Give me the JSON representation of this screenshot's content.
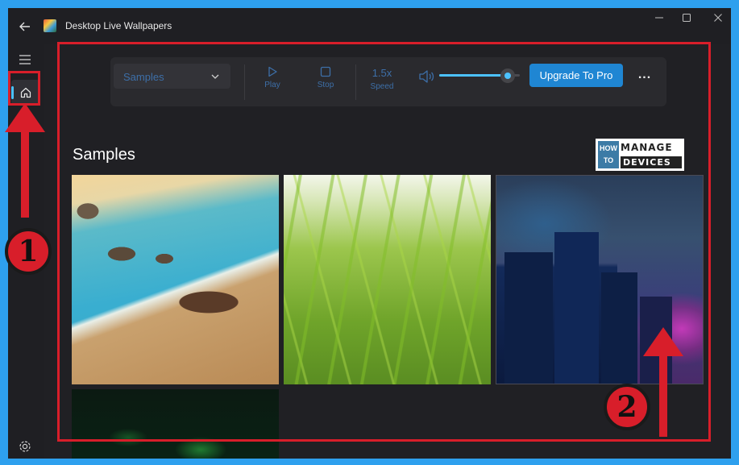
{
  "window": {
    "title": "Desktop Live Wallpapers"
  },
  "toolbar": {
    "source_selected": "Samples",
    "play_label": "Play",
    "stop_label": "Stop",
    "speed_value": "1.5x",
    "speed_label": "Speed",
    "volume_level": 0.85,
    "upgrade_label": "Upgrade To Pro",
    "more_label": "..."
  },
  "main": {
    "section_title": "Samples",
    "wallpapers": [
      {
        "name": "beach"
      },
      {
        "name": "grass"
      },
      {
        "name": "city"
      },
      {
        "name": "space"
      }
    ]
  },
  "brand": {
    "line1": "HOW",
    "line2": "TO",
    "manage": "MANAGE",
    "devices": "DEVICES"
  },
  "annotations": {
    "badge_1": "1",
    "badge_2": "2"
  },
  "colors": {
    "accent": "#4cc2ff",
    "button": "#1f86d3",
    "annotation": "#d81e2a",
    "frame": "#2ea0ee"
  },
  "icons": [
    "back-arrow-icon",
    "app-icon",
    "minimize-icon",
    "maximize-icon",
    "close-icon",
    "hamburger-icon",
    "home-icon",
    "settings-icon",
    "chevron-down-icon",
    "play-icon",
    "stop-icon",
    "volume-icon"
  ]
}
